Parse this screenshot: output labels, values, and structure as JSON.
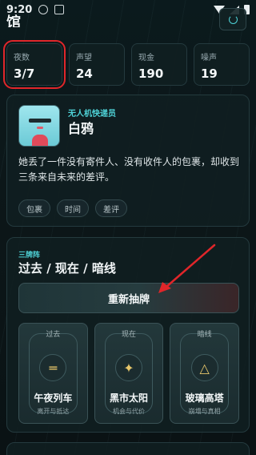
{
  "status_bar": {
    "time": "9:20"
  },
  "header": {
    "title": "馆"
  },
  "stats": [
    {
      "label": "夜数",
      "value": "3/7"
    },
    {
      "label": "声望",
      "value": "24"
    },
    {
      "label": "现金",
      "value": "190"
    },
    {
      "label": "噪声",
      "value": "19"
    }
  ],
  "courier": {
    "role": "无人机快递员",
    "name": "白鸦",
    "description": "她丢了一件没有寄件人、没有收件人的包裹，却收到三条来自未来的差评。",
    "tags": [
      "包裹",
      "时间",
      "差评"
    ]
  },
  "spread": {
    "kicker": "三牌阵",
    "title": "过去 / 现在 / 暗线",
    "redraw_label": "重新抽牌",
    "cards": [
      {
        "position": "过去",
        "glyph": "═",
        "name": "午夜列车",
        "subtitle": "离开与抵达"
      },
      {
        "position": "现在",
        "glyph": "✦",
        "name": "黑市太阳",
        "subtitle": "机会与代价"
      },
      {
        "position": "暗线",
        "glyph": "△",
        "name": "玻璃高塔",
        "subtitle": "崩塌与真相"
      }
    ]
  },
  "colors": {
    "accent": "#4fd3d8",
    "highlight": "#e0262a",
    "gold": "#e7c66a"
  }
}
